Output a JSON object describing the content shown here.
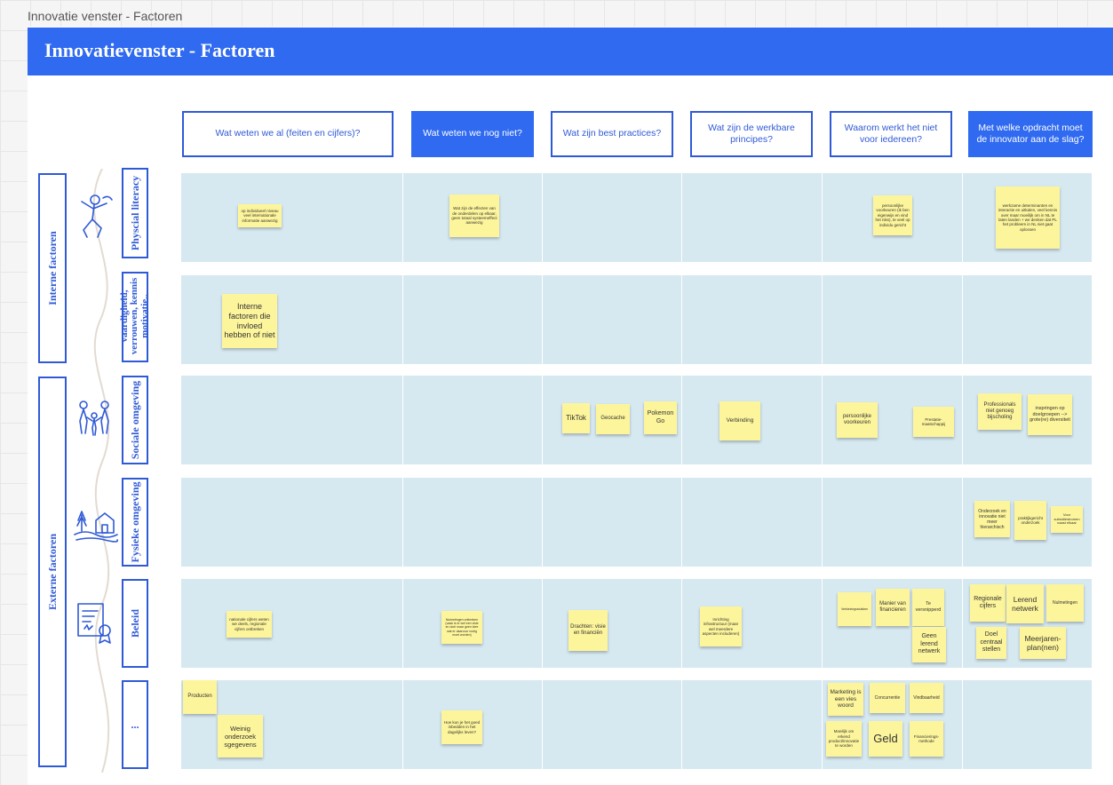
{
  "frame": {
    "title": "Innovatie venster - Factoren"
  },
  "banner": {
    "title": "Innovatievenster - Factoren"
  },
  "columns": [
    "Wat weten we al (feiten en cijfers)?",
    "Wat weten we nog niet?",
    "Wat zijn best practices?",
    "Wat zijn de werkbare principes?",
    "Waarom werkt het niet voor iedereen?",
    "Met welke opdracht moet de innovator aan de slag?"
  ],
  "groups": {
    "internal": "Interne factoren",
    "external": "Externe factoren"
  },
  "rows": [
    "Physcial literacy",
    "vaardigheid, verrouwen, kennis motivatie..",
    "Sociale omgeving",
    "Fysieke omgeving",
    "Beleid",
    "..."
  ],
  "icons": [
    "jumping-person-icon",
    "family-icon",
    "house-landscape-icon",
    "certificate-icon"
  ],
  "stickies": {
    "r1c1": "op individueel niveau veel internationale informatie aanwezig",
    "r1c2": "Wat zijn de effecten van de onderdelen op elkaar, geen totaal systeemeffect aanwezig",
    "r1c5": "persoonlijke voorkeuren (ik ben eigenwijs en vind het niks), te veel op individu gericht",
    "r1c6": "werkzame determinanten en interactie en uitkalen, veel kennis over maar moeilijk om in NL te laten landen + we denken dat PL het probleem in NL niet gaat oplossen",
    "r2c1": "Interne factoren die invloed hebben of niet",
    "r3c3a": "TikTok",
    "r3c3b": "Geocache",
    "r3c3c": "Pokemon Go",
    "r3c4": "Verbinding",
    "r3c5a": "persoonlijke voorkeuren",
    "r3c5b": "Prestatie-maatschappij",
    "r3c6a": "Professionals niet genoeg bijscholing",
    "r3c6b": "inspringen op doelgroepen --> grote(re) diversiteit",
    "r4c6a": "Onderzoek en innovatie niet meer hierarchisch",
    "r4c6b": "praktijkgericht onderzoek",
    "r4c6c": "Voor subsidiestromen naast elkaar",
    "r5c1": "nationale cijfers weten we deels, regionale cijfers ontbreken",
    "r5c2": "Nulmetingen ontbreken (vaak is er wel een visie en doel maar geen idee wat er daarvoor nodig moet worden)",
    "r5c3": "Drachten: visie en financiën",
    "r5c4": "Inrichting infrastructuur (maar wel meerdere aspecten includeren)",
    "r5c5a": "Verkiezingsstukken",
    "r5c5b": "Manier van financieren",
    "r5c5c": "Te versnipperd",
    "r5c5d": "Geen lerend netwerk",
    "r5c6a": "Regionale cijfers",
    "r5c6b": "Lerend netwerk",
    "r5c6c": "Nulmetingen",
    "r5c6d": "Doel centraal stellen",
    "r5c6e": "Meerjaren-plan(nen)",
    "r6c1a": "Producten",
    "r6c1b": "Weinig onderzoek sgegevens",
    "r6c2": "Hoe kun je het goed inbedden in het dagelijks leven?",
    "r6c5a": "Marketing is een vies woord",
    "r6c5b": "Concurrentie",
    "r6c5c": "Vindbaarheid",
    "r6c5d": "Moeilijk om erkend product/innovatie te worden",
    "r6c5e": "Geld",
    "r6c5f": "Financierings-methode"
  }
}
